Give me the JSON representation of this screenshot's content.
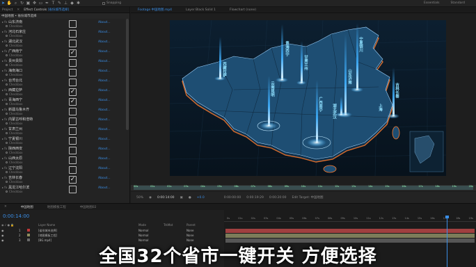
{
  "toolbar": {
    "tools": [
      "pointer",
      "hand",
      "zoom",
      "rotate",
      "camera",
      "pan-behind",
      "rect-mask",
      "pen",
      "type",
      "brush",
      "clone",
      "eraser",
      "puppet"
    ],
    "snapping": "Snapping",
    "workspaces": [
      "Essentials",
      "Standard"
    ]
  },
  "left_panel": {
    "tab_project": "Project",
    "tab_effects_prefix": "Effect Controls",
    "tab_effects_layer": "[省份城市选择]",
    "header": "中国地图 • 省份城市选择",
    "checkbox_sub_label": "Checkbox",
    "about_label": "About...",
    "rows": [
      {
        "name": "山东济南",
        "checked": false
      },
      {
        "name": "河北石家庄",
        "checked": false
      },
      {
        "name": "湖北武汉",
        "checked": false
      },
      {
        "name": "广西南宁",
        "checked": true
      },
      {
        "name": "贵州贵阳",
        "checked": false
      },
      {
        "name": "海南海口",
        "checked": false
      },
      {
        "name": "台湾台北",
        "checked": false
      },
      {
        "name": "西藏拉萨",
        "checked": true
      },
      {
        "name": "青海西宁",
        "checked": true
      },
      {
        "name": "新疆乌鲁木齐",
        "checked": false
      },
      {
        "name": "内蒙古呼和浩特",
        "checked": false
      },
      {
        "name": "甘肃兰州",
        "checked": false
      },
      {
        "name": "宁夏银川",
        "checked": false
      },
      {
        "name": "陕西西安",
        "checked": false
      },
      {
        "name": "山西太原",
        "checked": false
      },
      {
        "name": "辽宁沈阳",
        "checked": false
      },
      {
        "name": "吉林长春",
        "checked": true
      },
      {
        "name": "黑龙江哈尔滨",
        "checked": false
      }
    ]
  },
  "comp_panel": {
    "tabs": [
      "Footage 中国地图.mp4",
      "Layer Black Solid 1",
      "Flowchart (none)"
    ],
    "ruler_ticks": [
      "00s",
      "01s",
      "02s",
      "03s",
      "04s",
      "05s",
      "06s",
      "07s",
      "08s",
      "09s",
      "10s",
      "11s",
      "12s",
      "13s",
      "14s",
      "15s",
      "16s",
      "17s",
      "18s",
      "19s",
      "20s"
    ],
    "zoom": "50%",
    "timecode": "0:00:14:00",
    "in_point": "0:00:00:00",
    "duration": "0:00:19:29",
    "out_point": "0:00:20:00",
    "edit_target": "Edit Target: 中国地图",
    "delta": "+0.0",
    "map_labels": [
      {
        "text": "西藏拉萨",
        "color": "#8fe0ff"
      },
      {
        "text": "青海西宁",
        "color": "#8fe0ff"
      },
      {
        "text": "甘肃兰州",
        "color": "#8fe0ff"
      },
      {
        "text": "宁夏银川",
        "color": "#8fe0ff"
      },
      {
        "text": "吉林长春",
        "color": "#8fe0ff"
      },
      {
        "text": "山东济南",
        "color": "#8fe0ff"
      },
      {
        "text": "云南昆明",
        "color": "#8fe0ff"
      },
      {
        "text": "广西南宁",
        "color": "#8fe0ff"
      },
      {
        "text": "湖北武汉",
        "color": "#8fe0ff"
      },
      {
        "text": "上海",
        "color": "#8fe0ff"
      }
    ]
  },
  "timeline": {
    "tabs": [
      "中国地图",
      "地图模板工程",
      "中国地图02"
    ],
    "current_time": "0:00:14:00",
    "columns": {
      "source": "Layer Name",
      "mode": "Mode",
      "trkmat": "TrkMat",
      "parent": "Parent"
    },
    "layers": [
      {
        "index": "1",
        "name": "[省份城市选择]",
        "mode": "Normal",
        "parent": "None",
        "color": "#c03838"
      },
      {
        "index": "2",
        "name": "[地图模板工程]",
        "mode": "Normal",
        "parent": "None",
        "color": "#8e8e60"
      },
      {
        "index": "3",
        "name": "[BG.mp4]",
        "mode": "Normal",
        "parent": "None",
        "color": "#6a6a6a"
      }
    ],
    "ruler": [
      "0s",
      "01s",
      "02s",
      "03s",
      "04s",
      "05s",
      "06s",
      "07s",
      "08s",
      "09s",
      "10s",
      "11s",
      "12s",
      "13s",
      "14s",
      "15s",
      "16s",
      "17s",
      "18s",
      "19s"
    ]
  },
  "caption": "全国32个省市一键开关  方便选择",
  "colors": {
    "accent": "#3a8ee6",
    "map_glow": "#ff7a2a",
    "beam": "#3fb0ff"
  }
}
